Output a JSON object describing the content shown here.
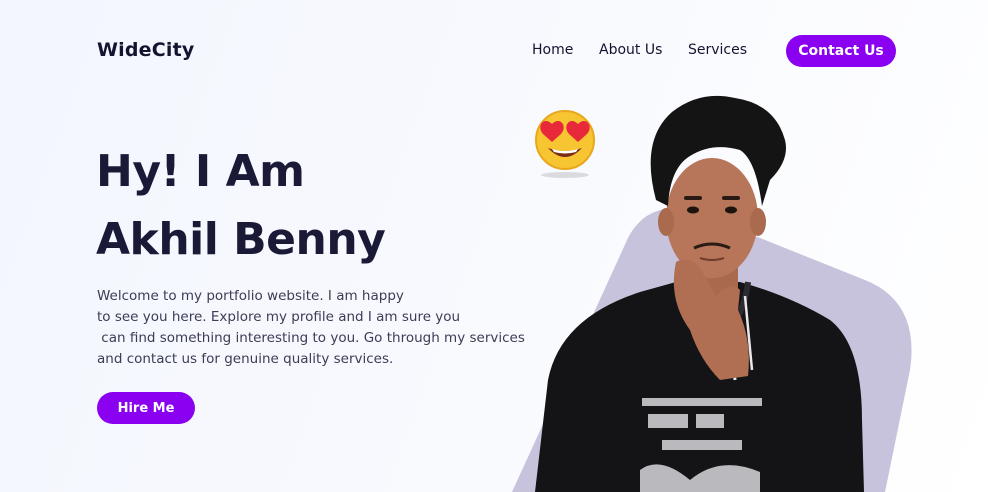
{
  "header": {
    "logo": "WideCity",
    "nav": [
      {
        "label": "Home"
      },
      {
        "label": "About Us"
      },
      {
        "label": "Services"
      }
    ],
    "contact_label": "Contact Us"
  },
  "hero": {
    "title_line1": "Hy! I Am",
    "title_line2": "Akhil Benny",
    "intro_lines": [
      "Welcome to my portfolio website. I am happy",
      "to see you here. Explore my profile and I am sure you",
      " can find something interesting to you. Go through my services",
      "and contact us for genuine quality services."
    ],
    "hire_label": "Hire Me"
  },
  "colors": {
    "accent": "#8a00f0",
    "heading": "#1a1a37",
    "blob": "#c7c3dd"
  },
  "icons": {
    "emoji": "heart-eyes-emoji-icon"
  }
}
